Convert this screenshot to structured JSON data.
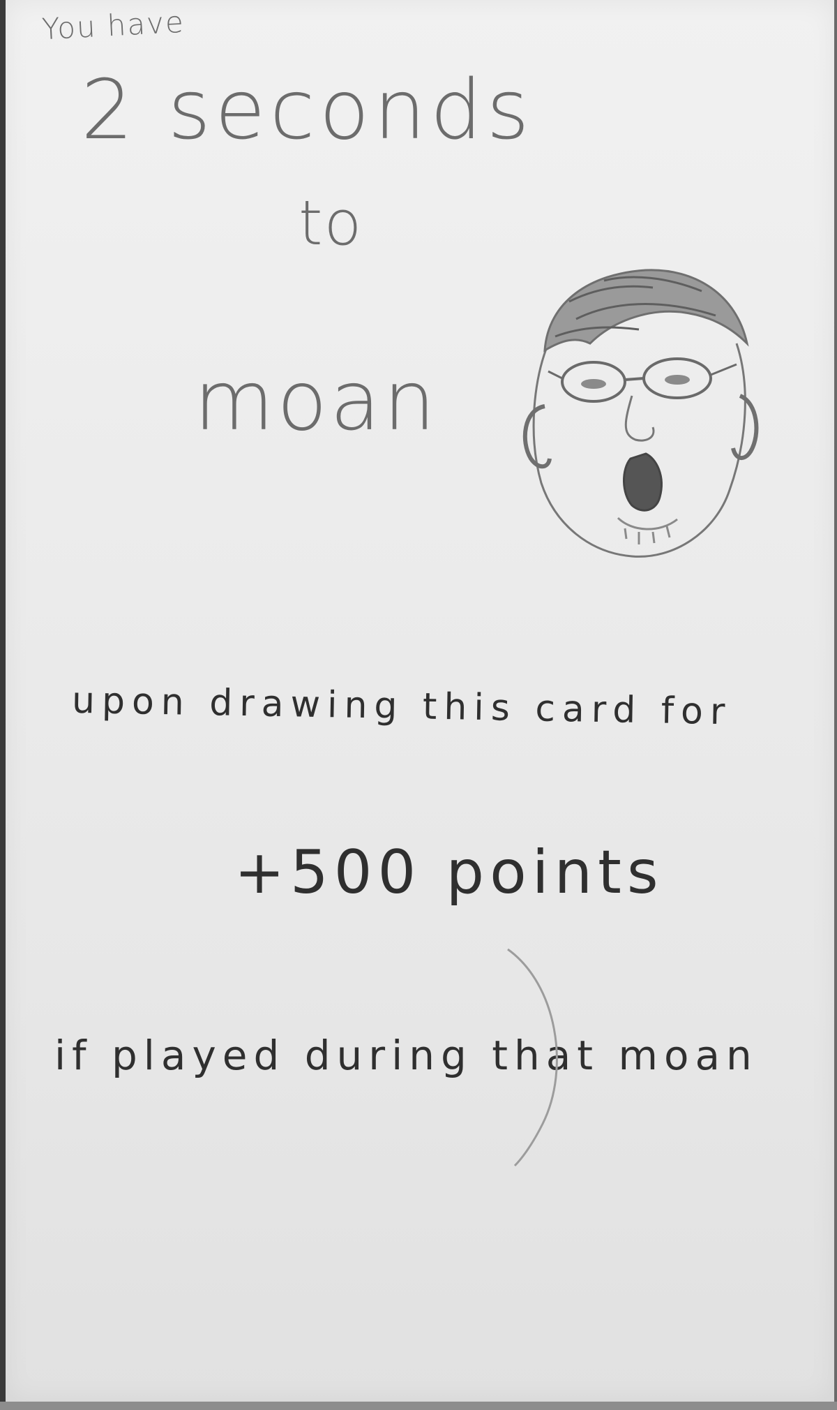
{
  "card": {
    "line1": "You have",
    "line2": "2 seconds",
    "line3": "to",
    "line4": "moan",
    "line5": "upon drawing this card for",
    "line6": "+500 points",
    "line7": "if played during that moan"
  },
  "drawing": {
    "icon": "moaning-face-sketch-icon"
  }
}
